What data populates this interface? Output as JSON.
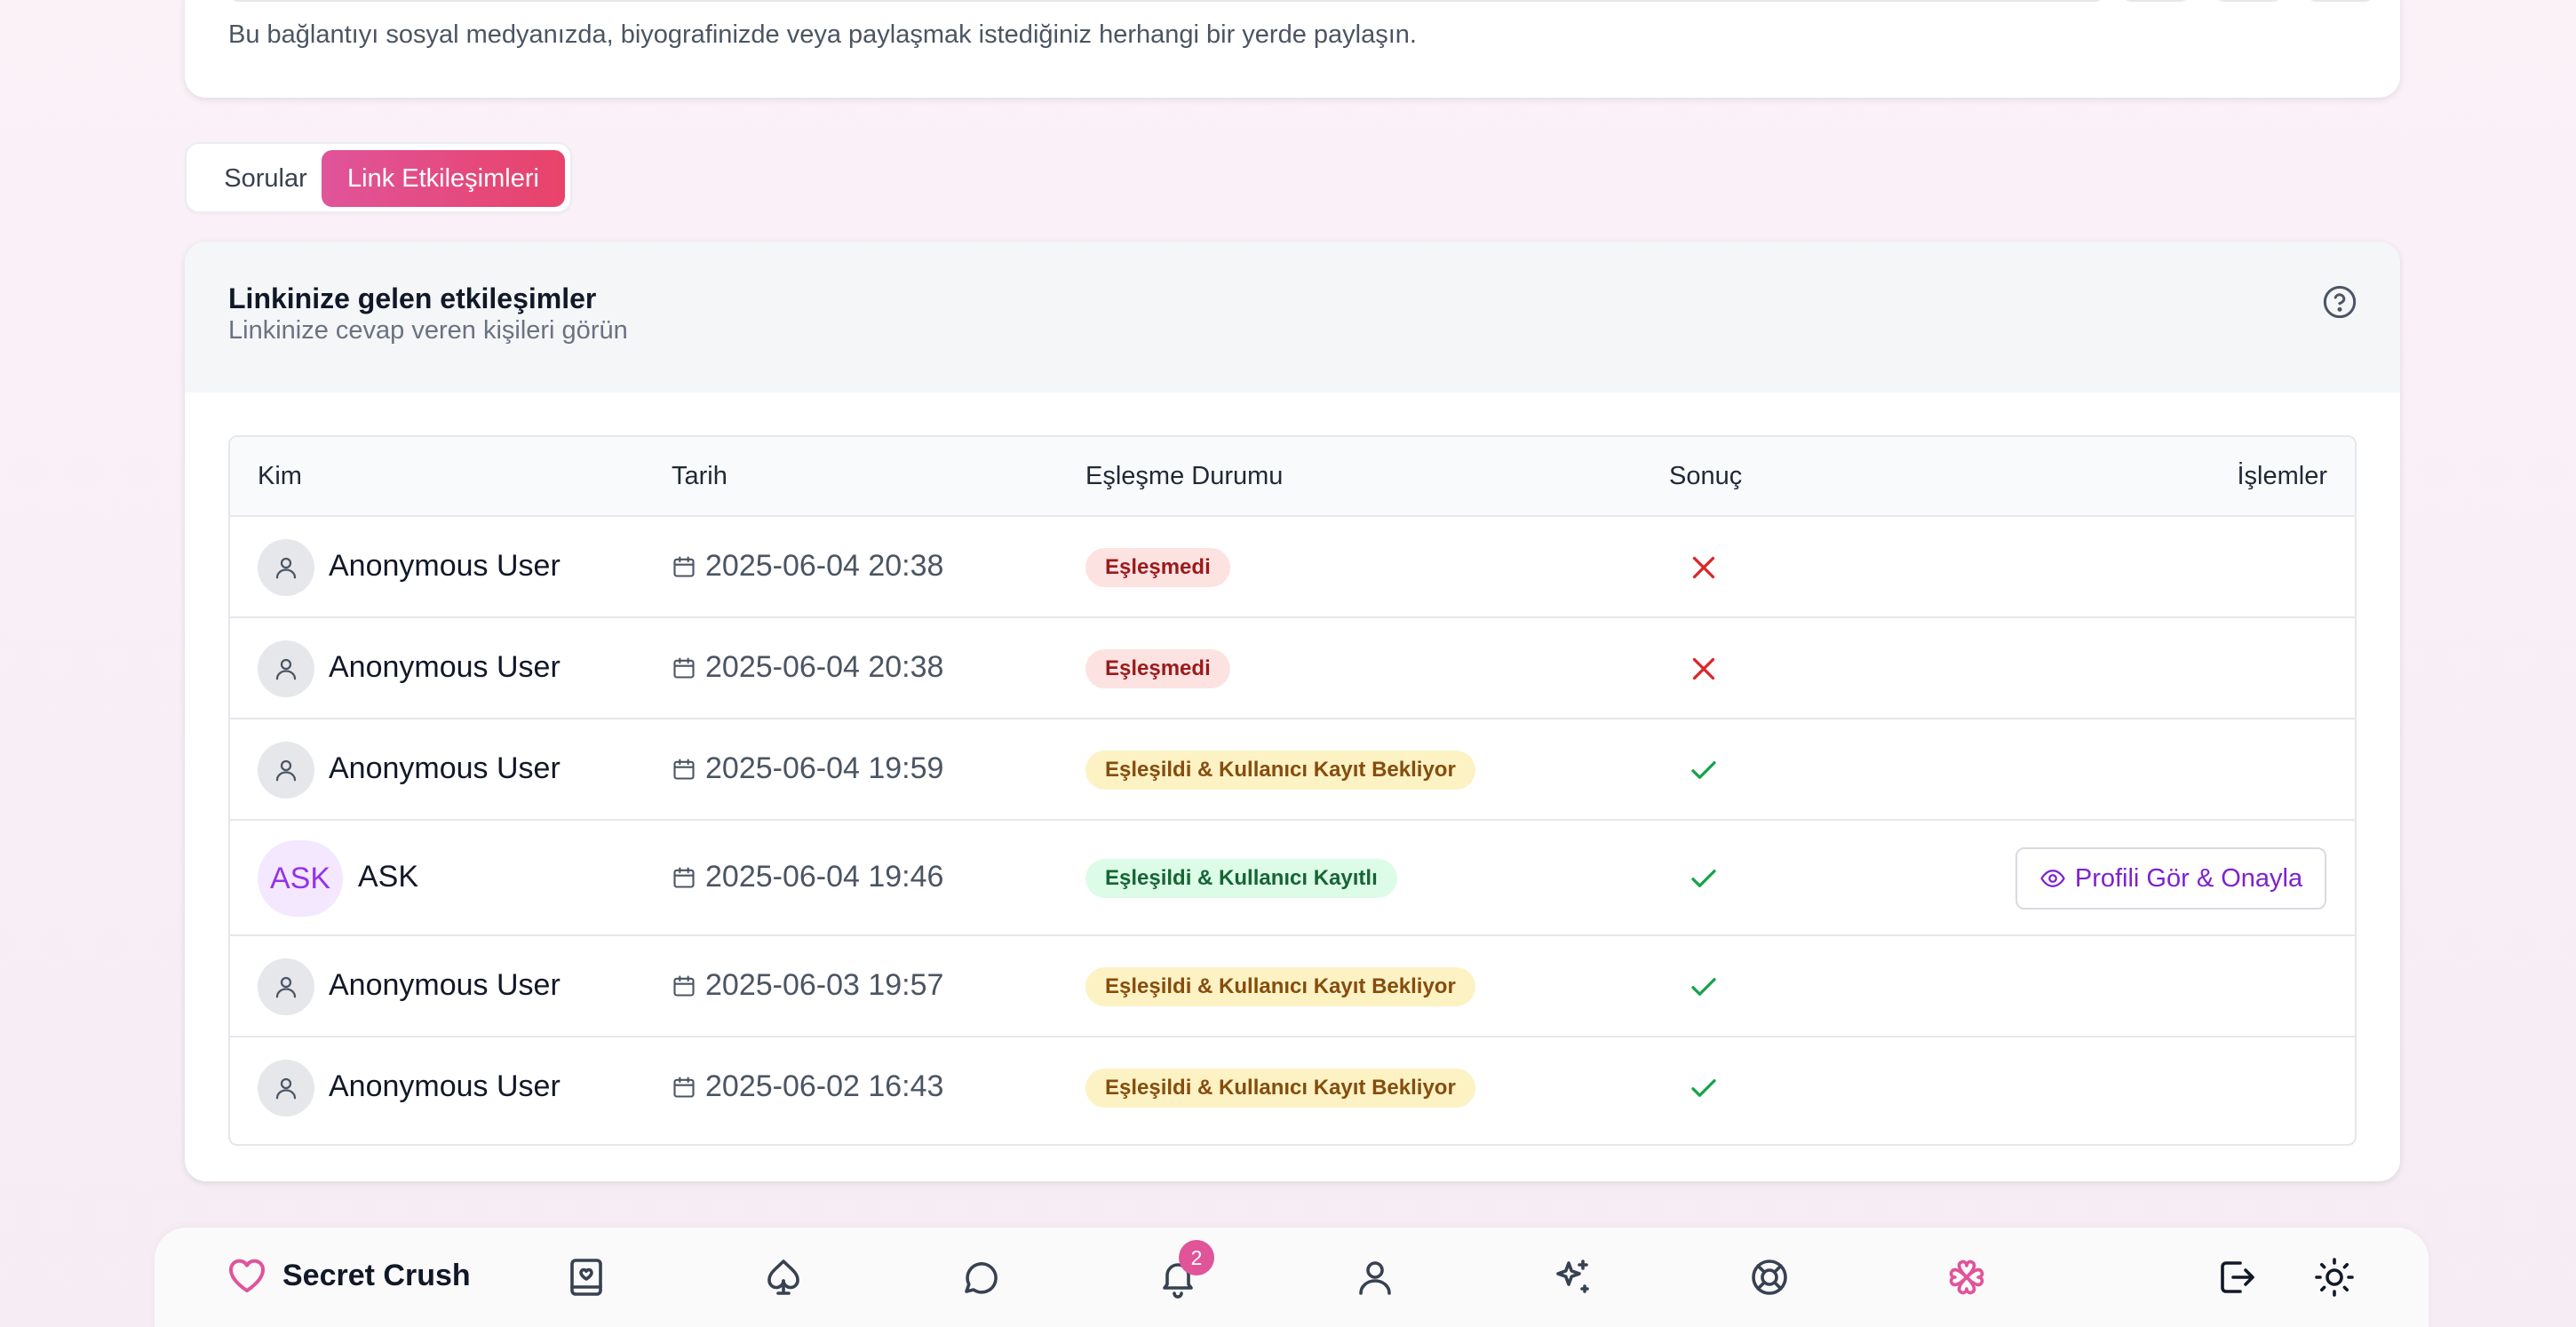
{
  "share": {
    "description": "Bu bağlantıyı sosyal medyanızda, biyografinizde veya paylaşmak istediğiniz herhangi bir yerde paylaşın."
  },
  "tabs": [
    {
      "label": "Sorular",
      "active": false
    },
    {
      "label": "Link Etkileşimleri",
      "active": true
    }
  ],
  "card": {
    "title": "Linkinize gelen etkileşimler",
    "subtitle": "Linkinize cevap veren kişileri görün"
  },
  "table": {
    "headers": [
      "Kim",
      "Tarih",
      "Eşleşme Durumu",
      "Sonuç",
      "İşlemler"
    ],
    "rows": [
      {
        "avatar": "user-icon",
        "name": "Anonymous User",
        "date": "2025-06-04 20:38",
        "status": "Eşleşmedi",
        "status_color": "#991b1b",
        "result": "x-icon",
        "action": ""
      },
      {
        "avatar": "user-icon",
        "name": "Anonymous User",
        "date": "2025-06-04 20:38",
        "status": "Eşleşmedi",
        "status_color": "#991b1b",
        "result": "x-icon",
        "action": ""
      },
      {
        "avatar": "user-icon",
        "name": "Anonymous User",
        "date": "2025-06-04 19:59",
        "status": "Eşleşildi & Kullanıcı Kayıt Bekliyor",
        "status_color": "#854d0e",
        "result": "check-icon",
        "action": ""
      },
      {
        "avatar": "ASK",
        "name": "ASK",
        "date": "2025-06-04 19:46",
        "status": "Eşleşildi & Kullanıcı Kayıtlı",
        "status_color": "#166534",
        "result": "check-icon",
        "action": "Profili Gör & Onayla"
      },
      {
        "avatar": "user-icon",
        "name": "Anonymous User",
        "date": "2025-06-03 19:57",
        "status": "Eşleşildi & Kullanıcı Kayıt Bekliyor",
        "status_color": "#854d0e",
        "result": "check-icon",
        "action": ""
      },
      {
        "avatar": "user-icon",
        "name": "Anonymous User",
        "date": "2025-06-02 16:43",
        "status": "Eşleşildi & Kullanıcı Kayıt Bekliyor",
        "status_color": "#854d0e",
        "result": "check-icon",
        "action": ""
      }
    ]
  },
  "nav": {
    "brand": "Secret Crush",
    "notification_count": "2",
    "icons": [
      "book-heart-icon",
      "spade-icon",
      "chat-icon",
      "bell-icon",
      "user-icon",
      "sparkles-icon",
      "lifebuoy-icon",
      "clover-icon",
      "logout-icon",
      "sun-icon"
    ],
    "accent": "#e0549a"
  }
}
